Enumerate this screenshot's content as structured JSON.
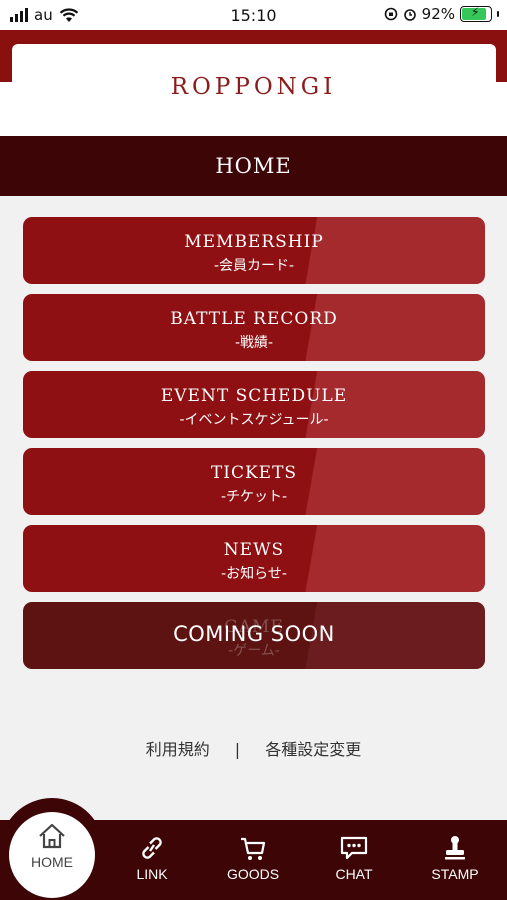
{
  "status_bar": {
    "carrier": "au",
    "time": "15:10",
    "battery_percent": "92%"
  },
  "header": {
    "brand": "ROPPONGI",
    "page_title": "HOME"
  },
  "menu": [
    {
      "en": "MEMBERSHIP",
      "ja": "-会員カード-"
    },
    {
      "en": "BATTLE RECORD",
      "ja": "-戦績-"
    },
    {
      "en": "EVENT SCHEDULE",
      "ja": "-イベントスケジュール-"
    },
    {
      "en": "TICKETS",
      "ja": "-チケット-"
    },
    {
      "en": "NEWS",
      "ja": "-お知らせ-"
    },
    {
      "en": "GAME",
      "ja": "-ゲーム-",
      "overlay": "COMING SOON"
    }
  ],
  "footer": {
    "terms": "利用規約",
    "separator": "|",
    "settings": "各種設定変更"
  },
  "tabs": [
    {
      "label": "HOME",
      "icon": "home-icon"
    },
    {
      "label": "LINK",
      "icon": "link-icon"
    },
    {
      "label": "GOODS",
      "icon": "cart-icon"
    },
    {
      "label": "CHAT",
      "icon": "chat-icon"
    },
    {
      "label": "STAMP",
      "icon": "stamp-icon"
    }
  ],
  "colors": {
    "brand_red": "#8f1013",
    "dark_maroon": "#3d0506",
    "background": "#f2f1f1"
  }
}
